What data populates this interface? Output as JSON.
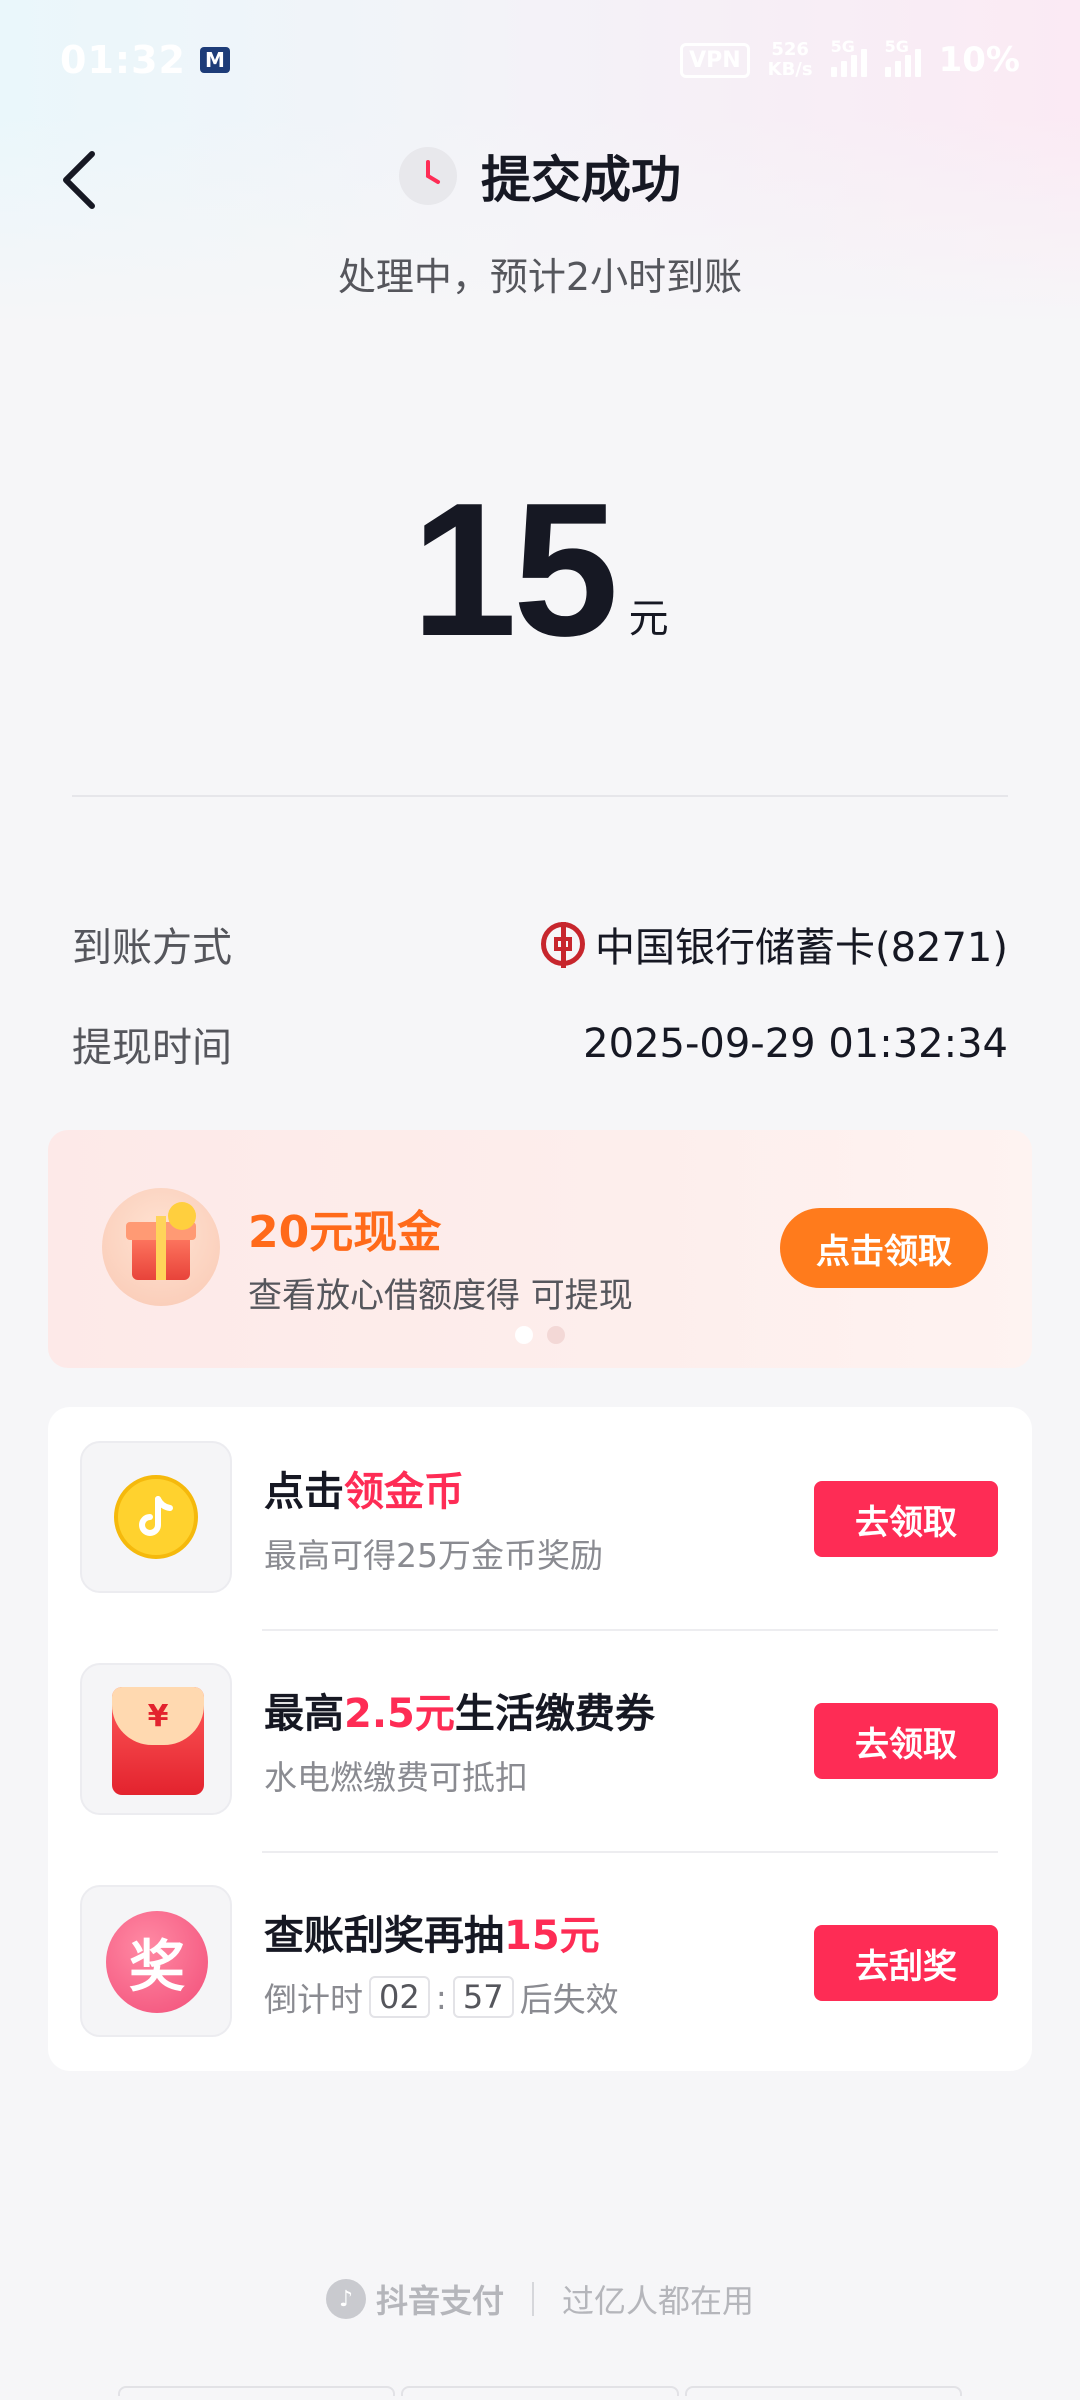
{
  "status_bar": {
    "time": "01:32",
    "vpn": "VPN",
    "net_speed_value": "526",
    "net_speed_unit": "KB/s",
    "network": "5G",
    "battery": "10%"
  },
  "header": {
    "title": "提交成功",
    "subtitle": "处理中，预计2小时到账"
  },
  "amount": {
    "value": "15",
    "unit": "元"
  },
  "details": {
    "method_label": "到账方式",
    "method_value": "中国银行储蓄卡(8271)",
    "time_label": "提现时间",
    "time_value": "2025-09-29 01:32:34"
  },
  "promo": {
    "title": "20元现金",
    "description": "查看放心借额度得 可提现",
    "button": "点击领取",
    "page_count": 2,
    "active_page": 1
  },
  "tasks": [
    {
      "title_prefix": "点击",
      "title_highlight": "领金币",
      "title_suffix": "",
      "description": "最高可得25万金币奖励",
      "button": "去领取",
      "icon": "tiktok-coin-icon"
    },
    {
      "title_prefix": "最高",
      "title_highlight": "2.5元",
      "title_suffix": "生活缴费券",
      "description": "水电燃缴费可抵扣",
      "button": "去领取",
      "icon": "red-packet-icon"
    },
    {
      "title_prefix": "查账刮奖再抽",
      "title_highlight": "15元",
      "title_suffix": "",
      "description_prefix": "倒计时",
      "timer_min": "02",
      "timer_sep": ":",
      "timer_sec": "57",
      "description_suffix": "后失效",
      "button": "去刮奖",
      "icon_text": "奖"
    }
  ],
  "footer": {
    "brand": "抖音支付",
    "slogan": "过亿人都在用"
  },
  "colors": {
    "accent_red": "#fe2c55",
    "promo_orange": "#ff7b1c",
    "bank_red": "#c7262d"
  }
}
